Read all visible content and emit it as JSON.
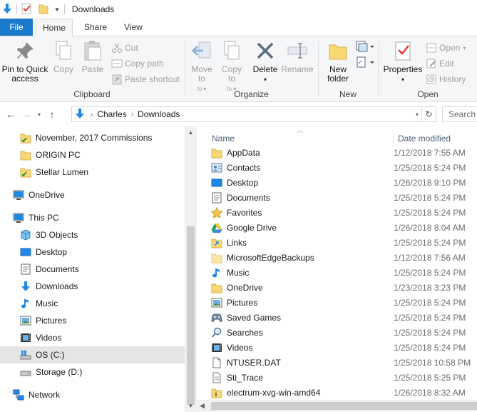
{
  "window": {
    "title": "Downloads"
  },
  "tabs": {
    "file": "File",
    "home": "Home",
    "share": "Share",
    "view": "View"
  },
  "ribbon": {
    "clipboard": {
      "label": "Clipboard",
      "pin": "Pin to Quick access",
      "copy": "Copy",
      "paste": "Paste",
      "cut": "Cut",
      "copy_path": "Copy path",
      "paste_shortcut": "Paste shortcut"
    },
    "organize": {
      "label": "Organize",
      "move_to": "Move to",
      "copy_to": "Copy to",
      "delete": "Delete",
      "rename": "Rename"
    },
    "new": {
      "label": "New",
      "new_folder": "New folder"
    },
    "open": {
      "label": "Open",
      "properties": "Properties",
      "open": "Open",
      "edit": "Edit",
      "history": "History"
    }
  },
  "address": {
    "crumbs": [
      "Charles",
      "Downloads"
    ]
  },
  "search": {
    "placeholder": "Search"
  },
  "nav": {
    "items": [
      {
        "label": "November, 2017 Commissions",
        "icon": "folder-check-icon"
      },
      {
        "label": "ORIGIN PC",
        "icon": "folder-icon"
      },
      {
        "label": "Stellar Lumen",
        "icon": "folder-check-icon"
      },
      {
        "label": "OneDrive",
        "icon": "cloud-icon"
      },
      {
        "label": "This PC",
        "icon": "computer-icon"
      },
      {
        "label": "3D Objects",
        "icon": "cube-icon"
      },
      {
        "label": "Desktop",
        "icon": "desktop-icon"
      },
      {
        "label": "Documents",
        "icon": "documents-icon"
      },
      {
        "label": "Downloads",
        "icon": "download-icon"
      },
      {
        "label": "Music",
        "icon": "music-icon"
      },
      {
        "label": "Pictures",
        "icon": "pictures-icon"
      },
      {
        "label": "Videos",
        "icon": "videos-icon"
      },
      {
        "label": "OS (C:)",
        "icon": "drive-icon",
        "selected": true
      },
      {
        "label": "Storage (D:)",
        "icon": "drive-icon"
      },
      {
        "label": "Network",
        "icon": "network-icon"
      }
    ]
  },
  "columns": {
    "name": "Name",
    "date": "Date modified"
  },
  "files": [
    {
      "name": "AppData",
      "date": "1/12/2018 7:55 AM",
      "icon": "folder-icon"
    },
    {
      "name": "Contacts",
      "date": "1/25/2018 5:24 PM",
      "icon": "contacts-icon"
    },
    {
      "name": "Desktop",
      "date": "1/26/2018 9:10 PM",
      "icon": "desktop-icon"
    },
    {
      "name": "Documents",
      "date": "1/25/2018 5:24 PM",
      "icon": "documents-icon"
    },
    {
      "name": "Favorites",
      "date": "1/25/2018 5:24 PM",
      "icon": "star-icon"
    },
    {
      "name": "Google Drive",
      "date": "1/26/2018 8:04 AM",
      "icon": "google-drive-icon"
    },
    {
      "name": "Links",
      "date": "1/25/2018 5:24 PM",
      "icon": "links-icon"
    },
    {
      "name": "MicrosoftEdgeBackups",
      "date": "1/12/2018 7:56 AM",
      "icon": "folder-icon"
    },
    {
      "name": "Music",
      "date": "1/25/2018 5:24 PM",
      "icon": "music-icon"
    },
    {
      "name": "OneDrive",
      "date": "1/23/2018 3:23 PM",
      "icon": "folder-icon"
    },
    {
      "name": "Pictures",
      "date": "1/25/2018 5:24 PM",
      "icon": "pictures-icon"
    },
    {
      "name": "Saved Games",
      "date": "1/25/2018 5:24 PM",
      "icon": "saved-games-icon"
    },
    {
      "name": "Searches",
      "date": "1/25/2018 5:24 PM",
      "icon": "search-icon"
    },
    {
      "name": "Videos",
      "date": "1/25/2018 5:24 PM",
      "icon": "videos-icon"
    },
    {
      "name": "NTUSER.DAT",
      "date": "1/25/2018 10:58 PM",
      "icon": "file-icon"
    },
    {
      "name": "Sti_Trace",
      "date": "1/25/2018 5:25 PM",
      "icon": "text-file-icon"
    },
    {
      "name": "electrum-xvg-win-amd64",
      "date": "1/26/2018 8:32 AM",
      "icon": "zip-icon"
    }
  ],
  "colors": {
    "accent": "#1979ca",
    "folder": "#f8d775",
    "ribbon_bg": "#f5f6f7",
    "selected": "#e5e5e5"
  }
}
